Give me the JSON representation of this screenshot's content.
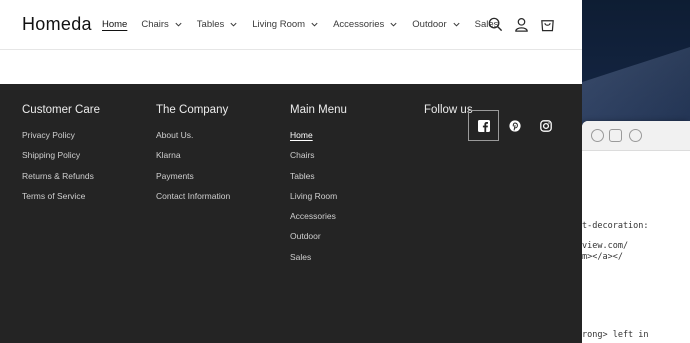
{
  "brand": {
    "logo": "Homeda"
  },
  "nav": {
    "items": [
      {
        "label": "Home",
        "has_dropdown": false,
        "active": true
      },
      {
        "label": "Chairs",
        "has_dropdown": true
      },
      {
        "label": "Tables",
        "has_dropdown": true
      },
      {
        "label": "Living Room",
        "has_dropdown": true
      },
      {
        "label": "Accessories",
        "has_dropdown": true
      },
      {
        "label": "Outdoor",
        "has_dropdown": true
      },
      {
        "label": "Sales",
        "has_dropdown": false
      }
    ]
  },
  "header_icons": [
    "search-icon",
    "account-icon",
    "cart-icon"
  ],
  "footer": {
    "customer_care": {
      "title": "Customer Care",
      "links": [
        "Privacy Policy",
        "Shipping Policy",
        "Returns & Refunds",
        "Terms of Service"
      ]
    },
    "company": {
      "title": "The Company",
      "links": [
        "About Us.",
        "Klarna",
        "Payments",
        "Contact Information"
      ]
    },
    "main_menu": {
      "title": "Main Menu",
      "links": [
        "Home",
        "Chairs",
        "Tables",
        "Living Room",
        "Accessories",
        "Outdoor",
        "Sales"
      ]
    },
    "follow": {
      "title": "Follow us",
      "icons": [
        "facebook-icon",
        "pinterest-icon",
        "instagram-icon"
      ]
    }
  },
  "background_window": {
    "code_lines": [
      "t-decoration:",
      "view.com/",
      "m></a></",
      "rong> left in"
    ]
  },
  "colors": {
    "footer_bg": "#242424",
    "header_bg": "#ffffff",
    "text_dark": "#121212"
  }
}
